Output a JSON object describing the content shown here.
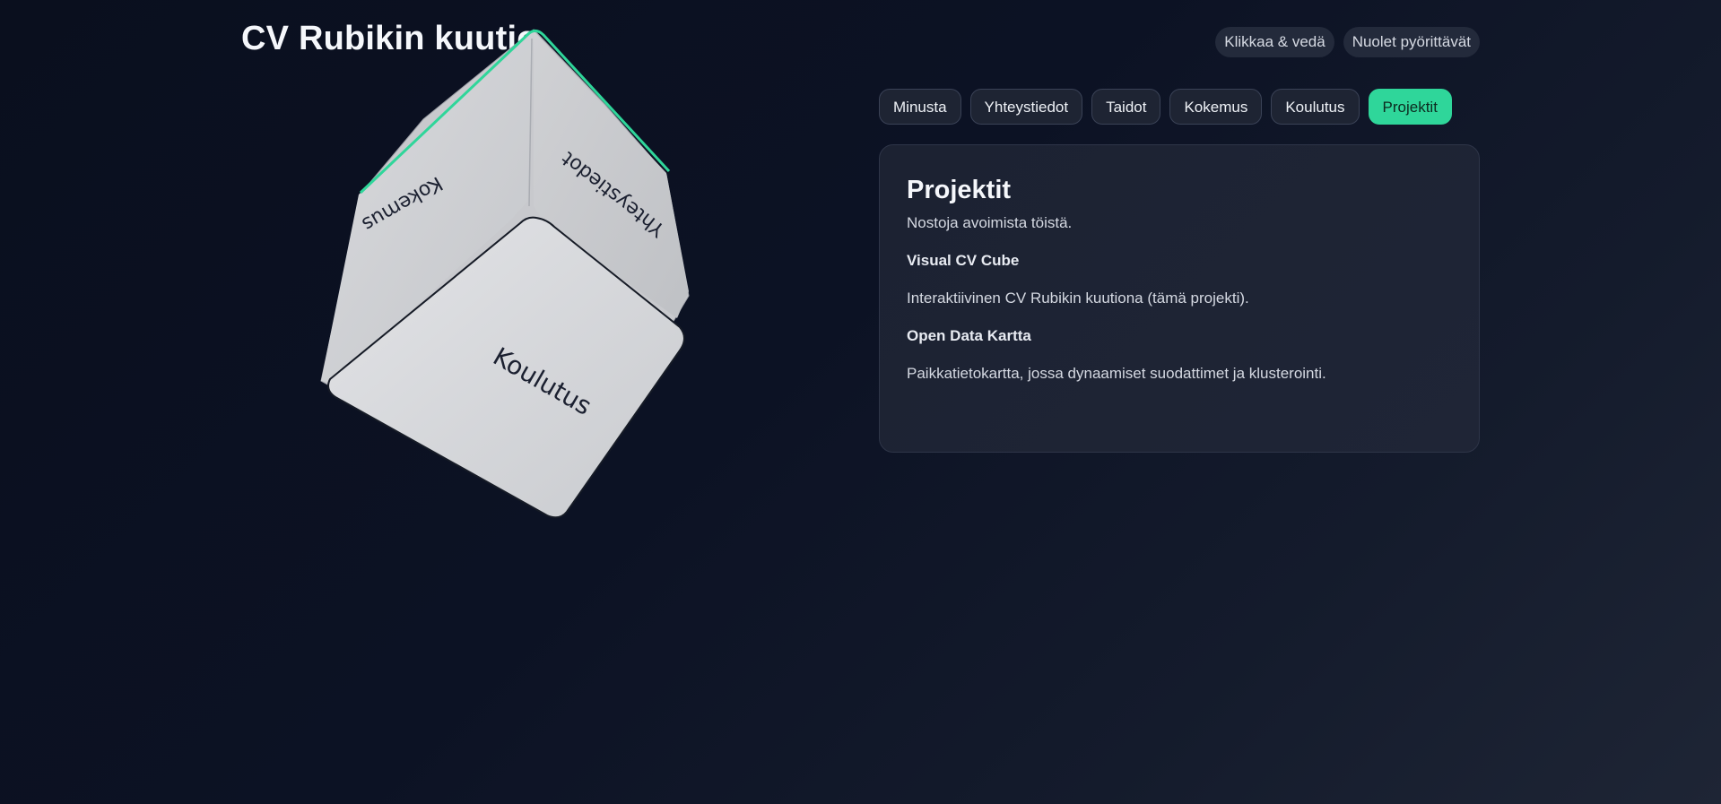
{
  "header": {
    "title": "CV Rubikin kuutio",
    "hints": [
      "Klikkaa & vedä",
      "Nuolet pyörittävät"
    ]
  },
  "tabs": [
    {
      "label": "Minusta",
      "active": false
    },
    {
      "label": "Yhteystiedot",
      "active": false
    },
    {
      "label": "Taidot",
      "active": false
    },
    {
      "label": "Kokemus",
      "active": false
    },
    {
      "label": "Koulutus",
      "active": false
    },
    {
      "label": "Projektit",
      "active": true
    }
  ],
  "panel": {
    "heading": "Projektit",
    "intro": "Nostoja avoimista töistä.",
    "projects": [
      {
        "title": "Visual CV Cube",
        "description": "Interaktiivinen CV Rubikin kuutiona (tämä projekti)."
      },
      {
        "title": "Open Data Kartta",
        "description": "Paikkatietokartta, jossa dynaamiset suodattimet ja klusterointi."
      }
    ]
  },
  "cube": {
    "faces": {
      "left": "Kokemus",
      "right": "Yhteystiedot",
      "front": "Koulutus"
    },
    "accent_color": "#2fd69a"
  },
  "colors": {
    "accent": "#2fd69a",
    "background": "#0a0f1e",
    "panel": "#1c2232"
  }
}
